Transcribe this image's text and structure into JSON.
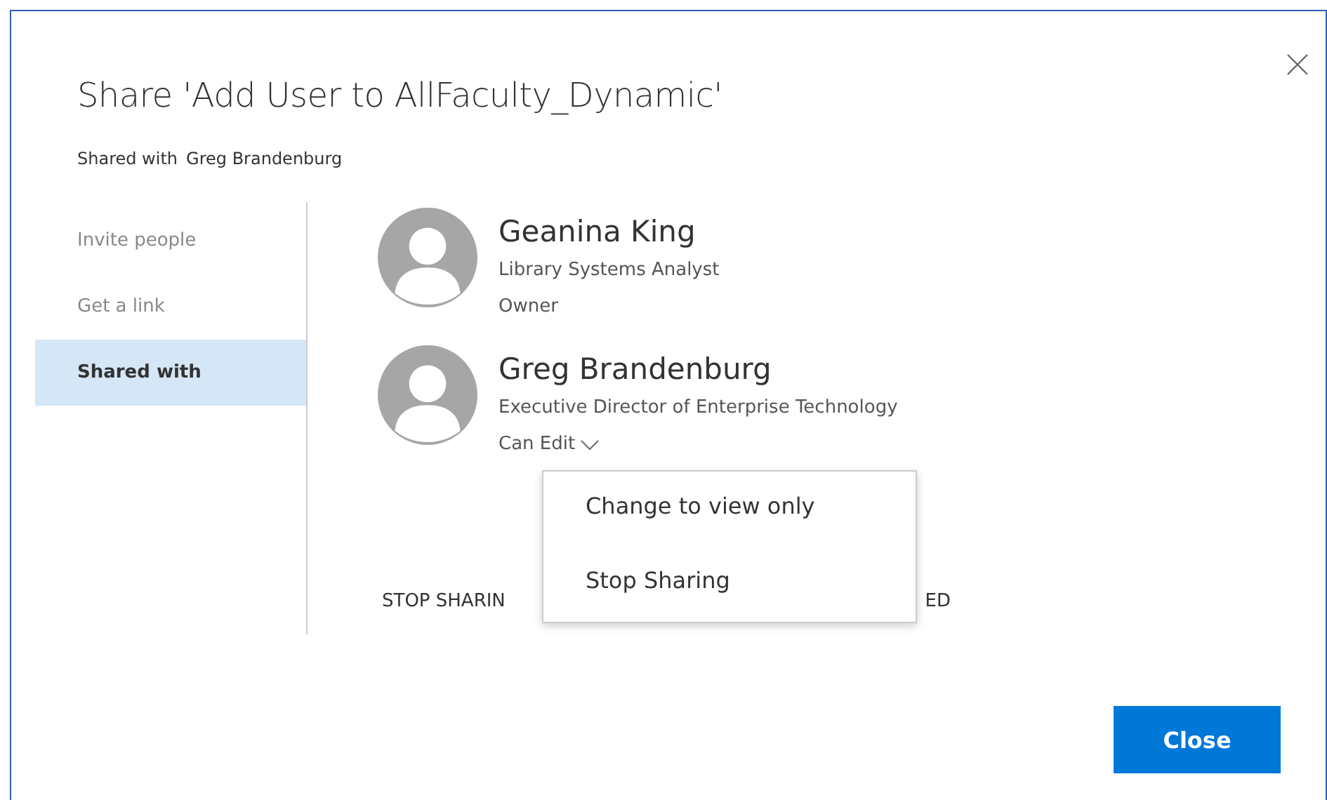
{
  "dialog": {
    "title": "Share 'Add User to AllFaculty_Dynamic'",
    "shared_with_label": "Shared with",
    "shared_with_value": "Greg Brandenburg"
  },
  "nav": [
    {
      "label": "Invite people",
      "selected": false
    },
    {
      "label": "Get a link",
      "selected": false
    },
    {
      "label": "Shared with",
      "selected": true
    }
  ],
  "people": [
    {
      "name": "Geanina King",
      "title": "Library Systems Analyst",
      "role": "Owner",
      "dropdown": false
    },
    {
      "name": "Greg Brandenburg",
      "title": "Executive Director of Enterprise Technology",
      "role": "Can Edit",
      "dropdown": true
    }
  ],
  "menu": [
    "Change to view only",
    "Stop Sharing"
  ],
  "footer_text": {
    "left": "STOP SHARIN",
    "right": "ED"
  },
  "buttons": [
    "Close"
  ]
}
